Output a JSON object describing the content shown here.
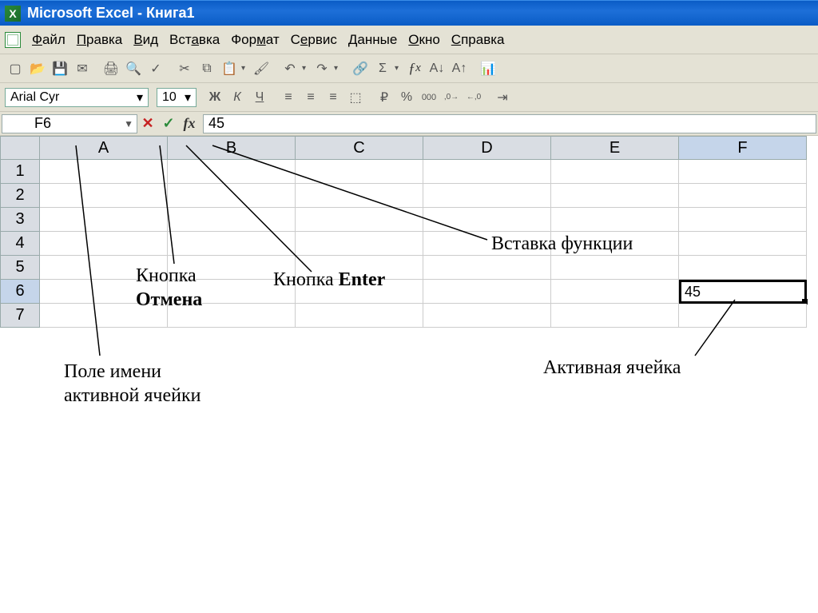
{
  "title": "Microsoft Excel - Книга1",
  "menu": {
    "items": [
      "Файл",
      "Правка",
      "Вид",
      "Вставка",
      "Формат",
      "Сервис",
      "Данные",
      "Окно",
      "Справка"
    ]
  },
  "toolbar": {
    "font": "Arial Cyr",
    "size": "10",
    "bold": "Ж",
    "italic": "К",
    "underline": "Ч",
    "currency": "%",
    "thousands": "000",
    "inc_dec1": "←,0",
    "inc_dec2": ",0→"
  },
  "formula_bar": {
    "name_box": "F6",
    "cancel": "✕",
    "enter": "✓",
    "fx": "fx",
    "value": "45"
  },
  "columns": [
    "A",
    "B",
    "C",
    "D",
    "E",
    "F"
  ],
  "rows": [
    "1",
    "2",
    "3",
    "4",
    "5",
    "6",
    "7"
  ],
  "active_cell": {
    "col": "F",
    "row": "6",
    "value": "45"
  },
  "annotations": {
    "name_field": "Поле имени\nактивной ячейки",
    "cancel_btn": "Кнопка\nОтмена",
    "enter_btn": "Кнопка Enter",
    "insert_fn": "Вставка функции",
    "active_cell": "Активная ячейка"
  }
}
